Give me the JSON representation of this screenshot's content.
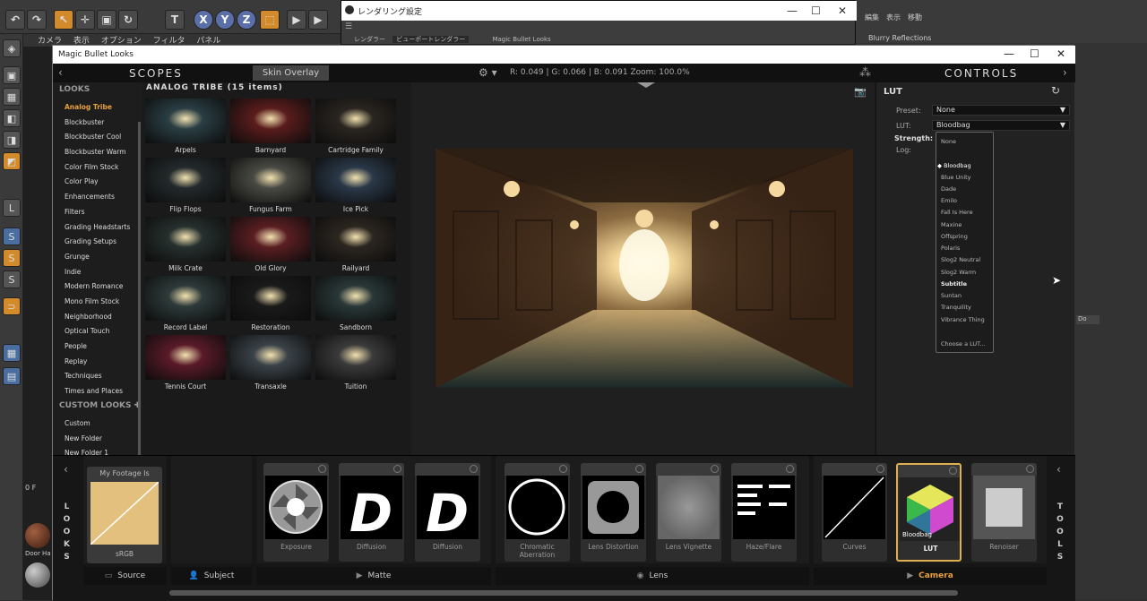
{
  "c4d": {
    "toolbar_xyz": [
      "X",
      "Y",
      "Z"
    ],
    "menu2": [
      "カメラ",
      "表示",
      "オプション",
      "フィルタ",
      "パネル"
    ],
    "frame_label": "0 F",
    "object_label": "Door Ha",
    "right_menu": [
      "編集",
      "表示",
      "移動"
    ],
    "right_item": "Blurry Reflections",
    "right_do": "Do"
  },
  "render_window": {
    "title": "レンダリング設定",
    "renderer_label": "レンダラー",
    "renderer_value": "ビューポートレンダラー",
    "mbl_label": "Magic Bullet Looks"
  },
  "window": {
    "title": "Magic Bullet Looks",
    "minimize": "—",
    "maximize": "☐",
    "close": "✕"
  },
  "header": {
    "left_chev": "‹",
    "scopes": "SCOPES",
    "skin_overlay": "Skin Overlay",
    "gear": "⚙ ▾",
    "rgb_readout": "R: 0.049 | G: 0.066 | B: 0.091    Zoom: 100.0%",
    "tri_icon": "⁂",
    "controls": "CONTROLS",
    "right_chev": "›"
  },
  "looks": {
    "header": "LOOKS",
    "items": [
      {
        "label": "Analog Tribe",
        "active": true
      },
      {
        "label": "Blockbuster"
      },
      {
        "label": "Blockbuster Cool"
      },
      {
        "label": "Blockbuster Warm"
      },
      {
        "label": "Color Film Stock"
      },
      {
        "label": "Color Play"
      },
      {
        "label": "Enhancements"
      },
      {
        "label": "Filters"
      },
      {
        "label": "Grading Headstarts"
      },
      {
        "label": "Grading Setups"
      },
      {
        "label": "Grunge"
      },
      {
        "label": "Indie"
      },
      {
        "label": "Modern Romance"
      },
      {
        "label": "Mono Film Stock"
      },
      {
        "label": "Neighborhood"
      },
      {
        "label": "Optical Touch"
      },
      {
        "label": "People"
      },
      {
        "label": "Replay"
      },
      {
        "label": "Techniques"
      },
      {
        "label": "Times and Places"
      }
    ],
    "custom_header": "CUSTOM LOOKS ✚",
    "custom_items": [
      "Custom",
      "New Folder",
      "New Folder 1"
    ]
  },
  "grid": {
    "title": "ANALOG TRIBE (15 items)",
    "items": [
      {
        "label": "Arpels",
        "tint": "#2a3e44"
      },
      {
        "label": "Barnyard",
        "tint": "#5a1c1c"
      },
      {
        "label": "Cartridge Family",
        "tint": "#2a2520"
      },
      {
        "label": "Flip Flops",
        "tint": "#232a2c"
      },
      {
        "label": "Fungus Farm",
        "tint": "#4a4a44"
      },
      {
        "label": "Ice Pick",
        "tint": "#2a3848"
      },
      {
        "label": "Milk Crate",
        "tint": "#26302e"
      },
      {
        "label": "Old Glory",
        "tint": "#5a1e22"
      },
      {
        "label": "Railyard",
        "tint": "#2c2620"
      },
      {
        "label": "Record Label",
        "tint": "#2e3a3a"
      },
      {
        "label": "Restoration",
        "tint": "#1a1a1a"
      },
      {
        "label": "Sandborn",
        "tint": "#2a3838"
      },
      {
        "label": "Tennis Court",
        "tint": "#5a1a28"
      },
      {
        "label": "Transaxle",
        "tint": "#3a4248"
      },
      {
        "label": "Tuition",
        "tint": "#3a3a3a"
      }
    ]
  },
  "controls": {
    "lut_header": "LUT",
    "reset_icon": "↻",
    "preset_label": "Preset:",
    "preset_value": "None",
    "lut_label": "LUT:",
    "lut_value": "Bloodbag",
    "strength_label": "Strength:",
    "log_label": "Log:",
    "dropdown_items": [
      {
        "label": "None"
      },
      {
        "label": "◆ Bloodbag",
        "selected": true
      },
      {
        "label": "Blue Unity"
      },
      {
        "label": "Dade"
      },
      {
        "label": "Emilo"
      },
      {
        "label": "Fall Is Here"
      },
      {
        "label": "Maxine"
      },
      {
        "label": "Offspring"
      },
      {
        "label": "Polaris"
      },
      {
        "label": "Slog2 Neutral"
      },
      {
        "label": "Slog2 Warm"
      },
      {
        "label": "Subtitle",
        "bold": true
      },
      {
        "label": "Suntan"
      },
      {
        "label": "Tranquility"
      },
      {
        "label": "Vibrance Thing"
      },
      {
        "label": "Choose a LUT..."
      }
    ]
  },
  "toolchain": {
    "left_chev": "‹",
    "right_chev": "‹",
    "looks_vertical": "LOOKS",
    "tools_vertical": "TOOLS",
    "source": {
      "title": "My Footage Is",
      "sub": "sRGB"
    },
    "tools": [
      {
        "label": "Exposure",
        "kind": "aperture"
      },
      {
        "label": "Diffusion",
        "kind": "d"
      },
      {
        "label": "Diffusion",
        "kind": "d"
      },
      {
        "label": "Chromatic Aberration",
        "kind": "ring"
      },
      {
        "label": "Lens Distortion",
        "kind": "lensdist"
      },
      {
        "label": "Lens Vignette",
        "kind": "vignette"
      },
      {
        "label": "Haze/Flare",
        "kind": "haze"
      },
      {
        "label": "Curves",
        "kind": "curves"
      },
      {
        "label": "LUT",
        "kind": "cube",
        "active": true,
        "overlay": "Bloodbag"
      },
      {
        "label": "Renoiser",
        "kind": "renoiser"
      }
    ],
    "stages": [
      {
        "label": "Source",
        "icon": "▭"
      },
      {
        "label": "Subject",
        "icon": "👤"
      },
      {
        "label": "Matte",
        "icon": "▶"
      },
      {
        "label": "Lens",
        "icon": "◉"
      },
      {
        "label": "Camera",
        "icon": "▶",
        "active": true
      }
    ]
  }
}
